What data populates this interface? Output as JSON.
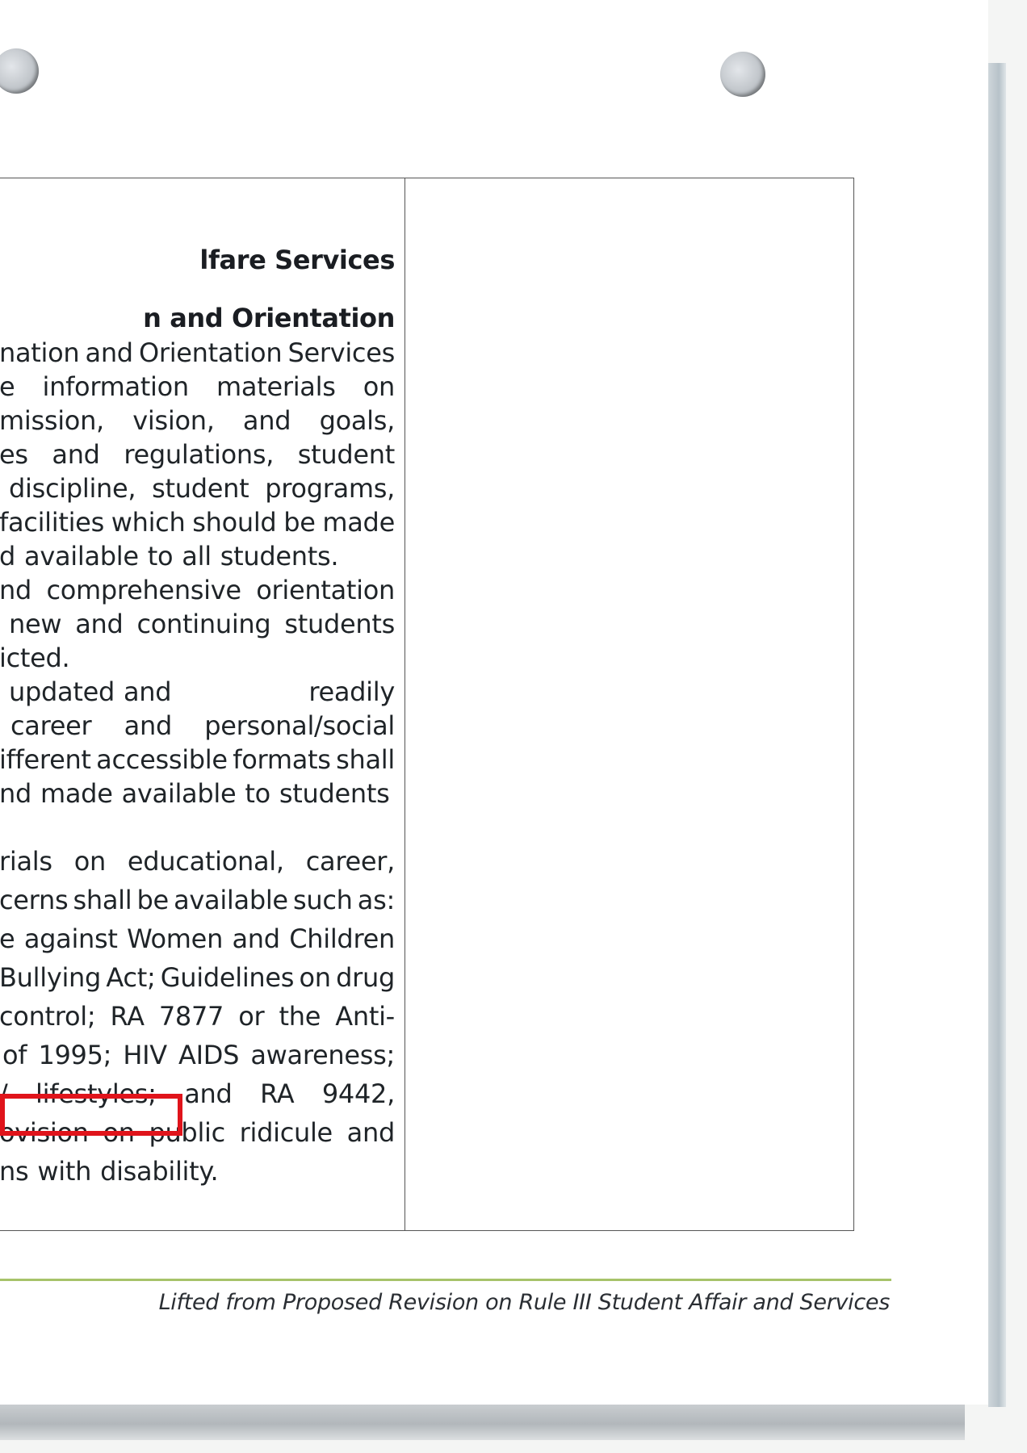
{
  "document": {
    "heading_1": "lfare Services",
    "heading_2": "n and Orientation",
    "para_1": [
      [
        "nation",
        "and",
        "Orientation",
        "Services"
      ],
      [
        "e",
        "information",
        "materials",
        "on"
      ],
      [
        "mission,",
        "vision,",
        "and",
        "goals,"
      ],
      [
        "es",
        "and",
        "regulations,",
        "student"
      ],
      [
        "discipline,",
        "student",
        "programs,"
      ],
      [
        "facilities",
        "which",
        "should",
        "be",
        "made"
      ],
      [
        "d",
        "available",
        "to",
        "all",
        "students."
      ]
    ],
    "para_2": [
      [
        "nd",
        "comprehensive",
        "orientation"
      ],
      [
        "new",
        "and",
        "continuing",
        "students"
      ],
      [
        "icted."
      ]
    ],
    "para_3": [
      [
        "updated",
        "and",
        "readily"
      ],
      [
        "career",
        "and",
        "personal/social"
      ],
      [
        "ifferent",
        "accessible",
        "formats",
        "shall"
      ],
      [
        "nd",
        "made",
        "available",
        "to",
        "students"
      ]
    ],
    "para_4": [
      [
        "rials",
        "on",
        "educational,",
        "career,"
      ],
      [
        "cerns",
        "shall",
        "be",
        "available",
        "such",
        "as:"
      ],
      [
        "e",
        "against",
        "Women",
        "and",
        "Children"
      ],
      [
        "Bullying",
        "Act;",
        "Guidelines",
        "on",
        "drug"
      ],
      [
        "control;",
        "RA",
        "7877",
        "or",
        "the",
        "Anti-"
      ],
      [
        "of",
        "1995;",
        "HIV",
        "AIDS",
        "awareness;"
      ],
      [
        "/",
        "lifestyles;",
        "and",
        "RA",
        "9442,"
      ],
      [
        "ovision",
        "on",
        "public",
        "ridicule",
        "and"
      ],
      [
        "ns",
        "with",
        "disability."
      ]
    ]
  },
  "footer": {
    "note": "Lifted from Proposed Revision on Rule III Student Affair and Services",
    "rule_color": "#a7c36a"
  },
  "annotation": {
    "highlight_color": "#e0141b"
  }
}
